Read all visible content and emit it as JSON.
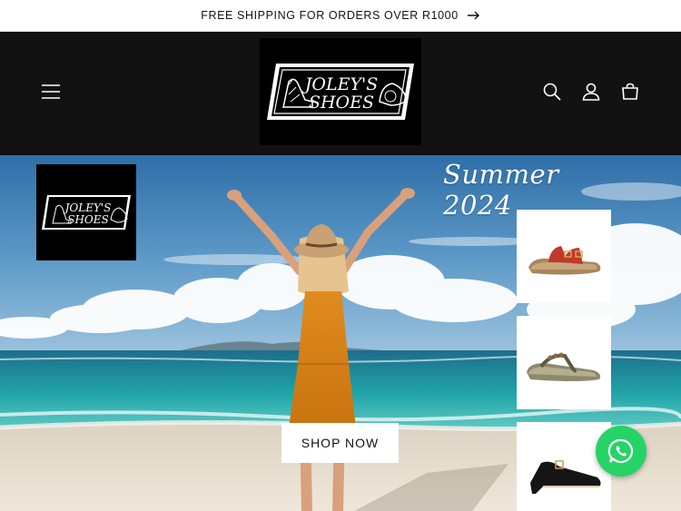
{
  "announcement": {
    "text": "FREE SHIPPING FOR ORDERS OVER R1000",
    "icon": "arrow-right-icon"
  },
  "header": {
    "menu_icon": "hamburger-menu-icon",
    "logo_text_line1": "JOLEY'S",
    "logo_text_line2": "SHOES",
    "icons": [
      "search-icon",
      "account-icon",
      "cart-icon"
    ],
    "background": "#121212"
  },
  "hero": {
    "heading": "Summer 2024",
    "shop_button_label": "SHOP NOW",
    "logo_text_line1": "JOLEY'S",
    "logo_text_line2": "SHOES",
    "products": [
      {
        "name": "red-sandal",
        "color": "#c0392b"
      },
      {
        "name": "olive-thong-sandal",
        "color": "#6b6a4f"
      },
      {
        "name": "black-buckle-sandal",
        "color": "#1a1a1a"
      }
    ]
  },
  "floating": {
    "whatsapp_icon": "whatsapp-icon",
    "color": "#25d366"
  }
}
